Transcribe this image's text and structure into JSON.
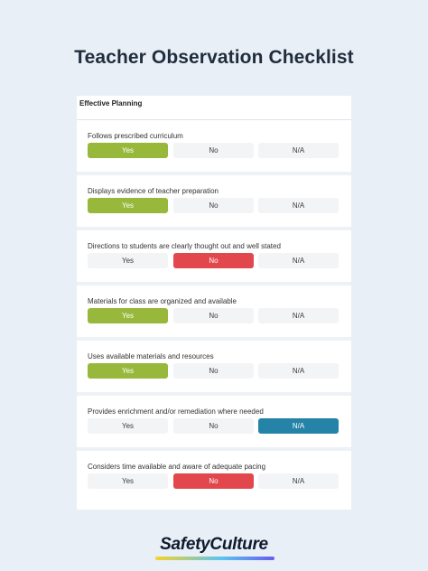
{
  "page": {
    "title": "Teacher Observation Checklist"
  },
  "section": {
    "title": "Effective Planning"
  },
  "option_labels": {
    "yes": "Yes",
    "no": "No",
    "na": "N/A"
  },
  "questions": [
    {
      "text": "Follows prescribed curriculum",
      "selected": "Yes"
    },
    {
      "text": "Displays evidence of teacher preparation",
      "selected": "Yes"
    },
    {
      "text": "Directions to students are clearly thought out and well stated",
      "selected": "No"
    },
    {
      "text": "Materials for class are organized and available",
      "selected": "Yes"
    },
    {
      "text": "Uses available materials and resources",
      "selected": "Yes"
    },
    {
      "text": "Provides enrichment and/or remediation where needed",
      "selected": "N/A"
    },
    {
      "text": "Considers time available and aware of adequate pacing",
      "selected": "No"
    }
  ],
  "colors": {
    "yes_selected": "#97b83b",
    "no_selected": "#e2474d",
    "na_selected": "#2683a8"
  },
  "brand": {
    "logo": "SafetyCulture"
  }
}
